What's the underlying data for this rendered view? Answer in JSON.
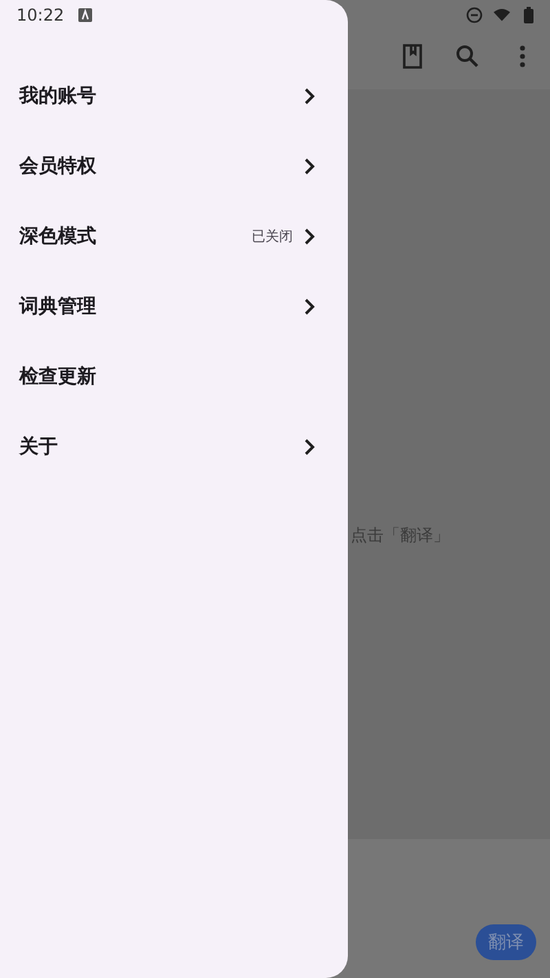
{
  "status_bar": {
    "time": "10:22"
  },
  "drawer": {
    "items": [
      {
        "label": "我的账号",
        "chevron": true
      },
      {
        "label": "会员特权",
        "chevron": true
      },
      {
        "label": "深色模式",
        "value": "已关闭",
        "chevron": true
      },
      {
        "label": "词典管理",
        "chevron": true
      },
      {
        "label": "检查更新",
        "chevron": false
      },
      {
        "label": "关于",
        "chevron": true
      }
    ]
  },
  "main": {
    "hint": "点击「翻译」",
    "translate_button": "翻译"
  }
}
